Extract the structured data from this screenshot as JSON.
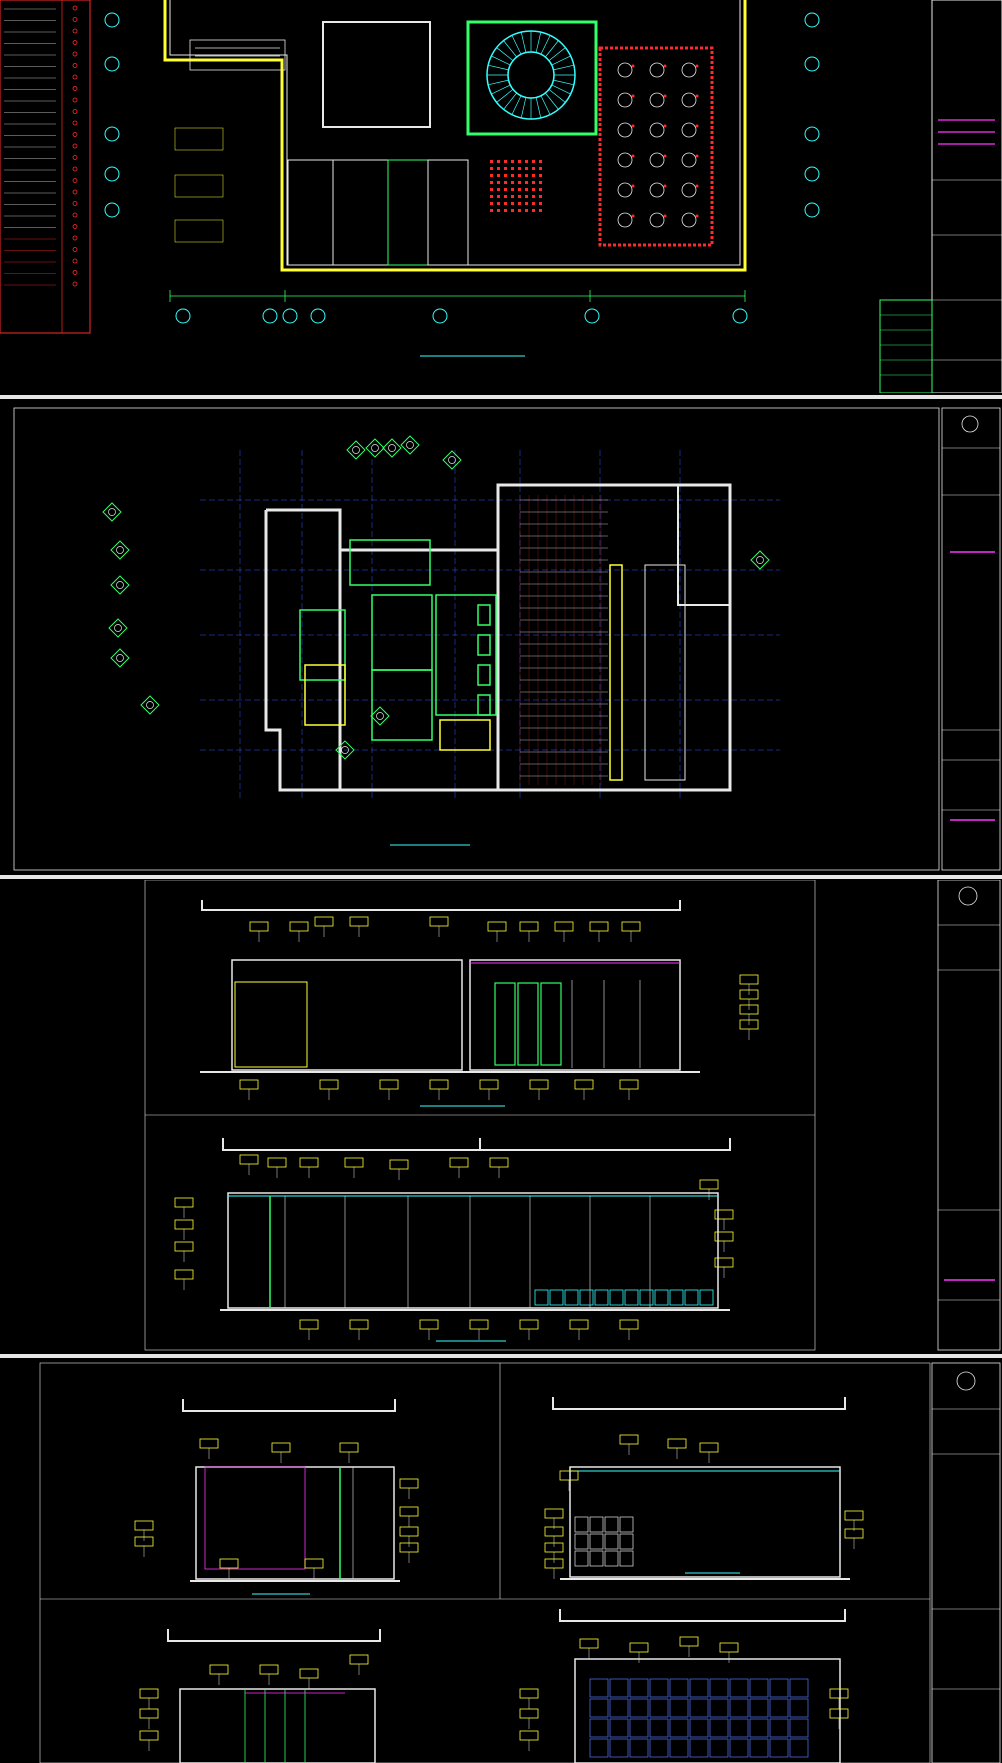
{
  "sheets": [
    {
      "id": "sheet1",
      "title": "",
      "scale": "",
      "legend": [
        "",
        "",
        "",
        "",
        "",
        "",
        "",
        "",
        "",
        "",
        "",
        "",
        "",
        "",
        "",
        "",
        "",
        "",
        "",
        "",
        "",
        "",
        "",
        "",
        ""
      ]
    },
    {
      "id": "sheet2",
      "title": "",
      "scale": ""
    },
    {
      "id": "sheet3",
      "elevation_titles": [
        "",
        ""
      ]
    },
    {
      "id": "sheet4",
      "elevation_titles": [
        "",
        ""
      ]
    }
  ],
  "colors": {
    "background": "#000000",
    "wall": "#e8e8e8",
    "structure_yellow": "#ffff33",
    "accent_green": "#33ff66",
    "accent_red": "#ff2a2a",
    "accent_cyan": "#33ffff",
    "accent_magenta": "#ff33ff",
    "grid_blue": "#3355ff"
  },
  "icons": [
    "north-arrow-icon",
    "section-marker-icon",
    "company-logo-icon"
  ]
}
